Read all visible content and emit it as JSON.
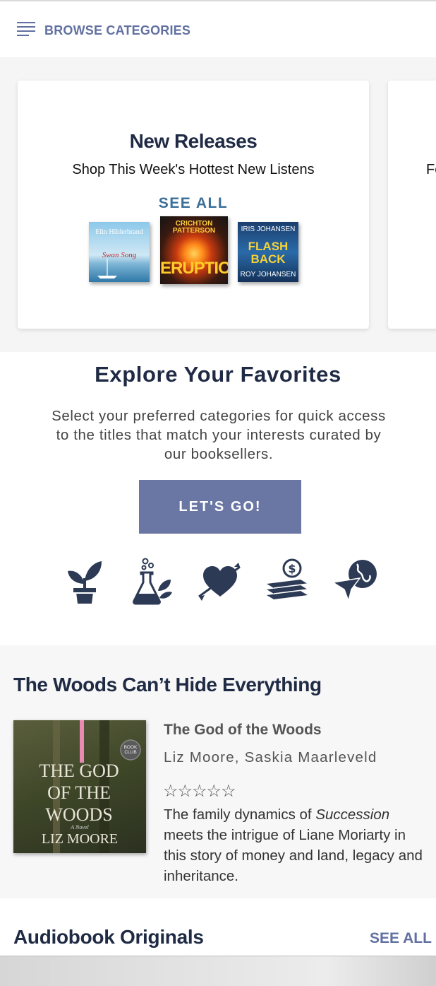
{
  "header": {
    "browse_label": "BROWSE CATEGORIES",
    "menu_icon": "hamburger-icon"
  },
  "carousel": {
    "cards": [
      {
        "title": "New Releases",
        "subtitle": "Shop This Week's Hottest New Listens",
        "see_all": "SEE ALL",
        "covers": [
          {
            "author": "Elin Hilderbrand",
            "title": "Swan Song"
          },
          {
            "top": "CRICHTON  PATTERSON",
            "title": "ERUPTION"
          },
          {
            "top": "IRIS JOHANSEN",
            "title": "FLASH BACK",
            "bottom": "ROY JOHANSEN"
          }
        ]
      },
      {
        "subtitle_fragment": "Fe"
      }
    ]
  },
  "explore": {
    "title": "Explore Your Favorites",
    "text": "Select your preferred categories for quick access to the titles that match your interests curated by our booksellers.",
    "button": "LET'S GO!",
    "icons": [
      "plant-icon",
      "science-flask-icon",
      "heart-arrow-icon",
      "money-books-icon",
      "travel-globe-icon"
    ]
  },
  "featured": {
    "heading": "The Woods Can’t Hide Everything",
    "book": {
      "title": "The God of the Woods",
      "authors": "Liz Moore, Saskia Maarleveld",
      "rating_display": "☆☆☆☆☆",
      "rating": 0,
      "desc_before": "The family dynamics of ",
      "desc_italic": "Succession",
      "desc_after": " meets the intrigue of Liane Moriarty in this story of money and land, legacy and inheritance.",
      "cover_title": "THE GOD OF THE WOODS",
      "cover_author": "LIZ MOORE",
      "cover_badge": "BOOK CLUB",
      "cover_sub": "A Novel"
    }
  },
  "originals": {
    "heading": "Audiobook Originals",
    "see_all": "SEE ALL"
  },
  "colors": {
    "navy": "#1f2a44",
    "accent": "#6a76a3",
    "link_blue": "#3a6f99"
  }
}
